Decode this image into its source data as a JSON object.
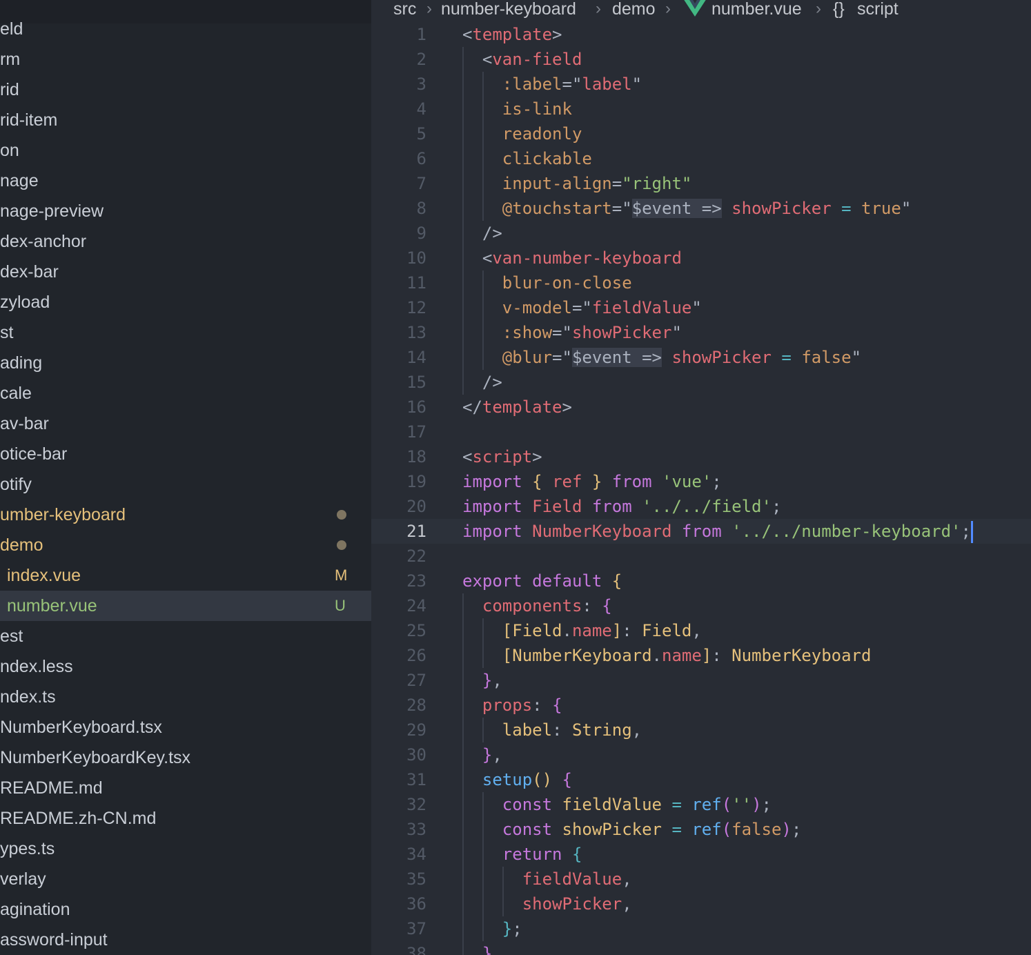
{
  "breadcrumb": {
    "src": "src",
    "folder": "number-keyboard",
    "sub": "demo",
    "file": "number.vue",
    "symbol_icon": "{}",
    "symbol": "script"
  },
  "colors": {
    "modified_badge": "#e5c07b",
    "untracked_badge": "#98c379"
  },
  "sidebar": {
    "items": [
      {
        "label": "eld"
      },
      {
        "label": "rm"
      },
      {
        "label": "rid"
      },
      {
        "label": "rid-item"
      },
      {
        "label": "on"
      },
      {
        "label": "nage"
      },
      {
        "label": "nage-preview"
      },
      {
        "label": "dex-anchor"
      },
      {
        "label": "dex-bar"
      },
      {
        "label": "zyload"
      },
      {
        "label": "st"
      },
      {
        "label": "ading"
      },
      {
        "label": "cale"
      },
      {
        "label": "av-bar"
      },
      {
        "label": "otice-bar"
      },
      {
        "label": "otify"
      },
      {
        "label": "umber-keyboard",
        "color": "#e5c07b",
        "dot": true
      },
      {
        "label": "demo",
        "color": "#e5c07b",
        "dot": true
      },
      {
        "label": "index.vue",
        "color": "#e5c07b",
        "badge": "M",
        "indent": true
      },
      {
        "label": "number.vue",
        "color": "#98c379",
        "badge": "U",
        "indent": true,
        "selected": true
      },
      {
        "label": "est"
      },
      {
        "label": "ndex.less"
      },
      {
        "label": "ndex.ts"
      },
      {
        "label": "NumberKeyboard.tsx"
      },
      {
        "label": "NumberKeyboardKey.tsx"
      },
      {
        "label": "README.md"
      },
      {
        "label": "README.zh-CN.md"
      },
      {
        "label": "ypes.ts"
      },
      {
        "label": "verlay"
      },
      {
        "label": "agination"
      },
      {
        "label": "assword-input"
      }
    ]
  },
  "editor": {
    "current_line": 21,
    "lines": [
      {
        "n": "1",
        "g": [],
        "s": [
          [
            "t-punc",
            "<"
          ],
          [
            "t-tag",
            "template"
          ],
          [
            "t-punc",
            ">"
          ]
        ]
      },
      {
        "n": "2",
        "g": [
          0
        ],
        "s": [
          [
            "t-punc",
            "  <"
          ],
          [
            "t-tag",
            "van-field"
          ]
        ]
      },
      {
        "n": "3",
        "g": [
          0,
          1
        ],
        "s": [
          [
            "t-attr",
            "    :label"
          ],
          [
            "t-punc",
            "=\""
          ],
          [
            "t-var",
            "label"
          ],
          [
            "t-punc",
            "\""
          ]
        ]
      },
      {
        "n": "4",
        "g": [
          0,
          1
        ],
        "s": [
          [
            "t-attr",
            "    is-link"
          ]
        ]
      },
      {
        "n": "5",
        "g": [
          0,
          1
        ],
        "s": [
          [
            "t-attr",
            "    readonly"
          ]
        ]
      },
      {
        "n": "6",
        "g": [
          0,
          1
        ],
        "s": [
          [
            "t-attr",
            "    clickable"
          ]
        ]
      },
      {
        "n": "7",
        "g": [
          0,
          1
        ],
        "s": [
          [
            "t-attr",
            "    input-align"
          ],
          [
            "t-punc",
            "="
          ],
          [
            "t-str",
            "\"right\""
          ]
        ]
      },
      {
        "n": "8",
        "g": [
          0,
          1
        ],
        "s": [
          [
            "t-attr",
            "    @touchstart"
          ],
          [
            "t-punc",
            "=\""
          ],
          [
            "t-hl",
            "$event =>"
          ],
          [
            "t-punc",
            " "
          ],
          [
            "t-var",
            "showPicker"
          ],
          [
            "t-punc",
            " "
          ],
          [
            "t-op",
            "="
          ],
          [
            "t-punc",
            " "
          ],
          [
            "t-num",
            "true"
          ],
          [
            "t-punc",
            "\""
          ]
        ]
      },
      {
        "n": "9",
        "g": [
          0
        ],
        "s": [
          [
            "t-punc",
            "  />"
          ]
        ]
      },
      {
        "n": "10",
        "g": [
          0
        ],
        "s": [
          [
            "t-punc",
            "  <"
          ],
          [
            "t-tag",
            "van-number-keyboard"
          ]
        ]
      },
      {
        "n": "11",
        "g": [
          0,
          1
        ],
        "s": [
          [
            "t-attr",
            "    blur-on-close"
          ]
        ]
      },
      {
        "n": "12",
        "g": [
          0,
          1
        ],
        "s": [
          [
            "t-attr",
            "    v-model"
          ],
          [
            "t-punc",
            "=\""
          ],
          [
            "t-var",
            "fieldValue"
          ],
          [
            "t-punc",
            "\""
          ]
        ]
      },
      {
        "n": "13",
        "g": [
          0,
          1
        ],
        "s": [
          [
            "t-attr",
            "    :show"
          ],
          [
            "t-punc",
            "=\""
          ],
          [
            "t-var",
            "showPicker"
          ],
          [
            "t-punc",
            "\""
          ]
        ]
      },
      {
        "n": "14",
        "g": [
          0,
          1
        ],
        "s": [
          [
            "t-attr",
            "    @blur"
          ],
          [
            "t-punc",
            "=\""
          ],
          [
            "t-hl",
            "$event =>"
          ],
          [
            "t-punc",
            " "
          ],
          [
            "t-var",
            "showPicker"
          ],
          [
            "t-punc",
            " "
          ],
          [
            "t-op",
            "="
          ],
          [
            "t-punc",
            " "
          ],
          [
            "t-num",
            "false"
          ],
          [
            "t-punc",
            "\""
          ]
        ]
      },
      {
        "n": "15",
        "g": [
          0
        ],
        "s": [
          [
            "t-punc",
            "  />"
          ]
        ]
      },
      {
        "n": "16",
        "g": [],
        "s": [
          [
            "t-punc",
            "</"
          ],
          [
            "t-tag",
            "template"
          ],
          [
            "t-punc",
            ">"
          ]
        ]
      },
      {
        "n": "17",
        "g": [],
        "s": []
      },
      {
        "n": "18",
        "g": [],
        "s": [
          [
            "t-punc",
            "<"
          ],
          [
            "t-tag",
            "script"
          ],
          [
            "t-punc",
            ">"
          ]
        ]
      },
      {
        "n": "19",
        "g": [],
        "s": [
          [
            "t-kw",
            "import"
          ],
          [
            "t-punc",
            " "
          ],
          [
            "t-cls",
            "{"
          ],
          [
            "t-punc",
            " "
          ],
          [
            "t-var",
            "ref"
          ],
          [
            "t-punc",
            " "
          ],
          [
            "t-cls",
            "}"
          ],
          [
            "t-punc",
            " "
          ],
          [
            "t-kw",
            "from"
          ],
          [
            "t-punc",
            " "
          ],
          [
            "t-str",
            "'vue'"
          ],
          [
            "t-punc",
            ";"
          ]
        ]
      },
      {
        "n": "20",
        "g": [],
        "s": [
          [
            "t-kw",
            "import"
          ],
          [
            "t-punc",
            " "
          ],
          [
            "t-var",
            "Field"
          ],
          [
            "t-punc",
            " "
          ],
          [
            "t-kw",
            "from"
          ],
          [
            "t-punc",
            " "
          ],
          [
            "t-str",
            "'../../field'"
          ],
          [
            "t-punc",
            ";"
          ]
        ]
      },
      {
        "n": "21",
        "g": [],
        "s": [
          [
            "t-kw",
            "import"
          ],
          [
            "t-punc",
            " "
          ],
          [
            "t-var",
            "NumberKeyboard"
          ],
          [
            "t-punc",
            " "
          ],
          [
            "t-kw",
            "from"
          ],
          [
            "t-punc",
            " "
          ],
          [
            "t-str",
            "'../../number-keyboard'"
          ],
          [
            "t-punc",
            ";"
          ]
        ]
      },
      {
        "n": "22",
        "g": [],
        "s": []
      },
      {
        "n": "23",
        "g": [],
        "s": [
          [
            "t-kw",
            "export"
          ],
          [
            "t-punc",
            " "
          ],
          [
            "t-kw",
            "default"
          ],
          [
            "t-punc",
            " "
          ],
          [
            "t-cls",
            "{"
          ]
        ]
      },
      {
        "n": "24",
        "g": [
          0
        ],
        "s": [
          [
            "t-var",
            "  components"
          ],
          [
            "t-punc",
            ": "
          ],
          [
            "t-kw",
            "{"
          ]
        ]
      },
      {
        "n": "25",
        "g": [
          0,
          1
        ],
        "s": [
          [
            "t-cls",
            "    ["
          ],
          [
            "t-cls",
            "Field"
          ],
          [
            "t-punc",
            "."
          ],
          [
            "t-var",
            "name"
          ],
          [
            "t-cls",
            "]"
          ],
          [
            "t-punc",
            ": "
          ],
          [
            "t-cls",
            "Field"
          ],
          [
            "t-punc",
            ","
          ]
        ]
      },
      {
        "n": "26",
        "g": [
          0,
          1
        ],
        "s": [
          [
            "t-cls",
            "    ["
          ],
          [
            "t-cls",
            "NumberKeyboard"
          ],
          [
            "t-punc",
            "."
          ],
          [
            "t-var",
            "name"
          ],
          [
            "t-cls",
            "]"
          ],
          [
            "t-punc",
            ": "
          ],
          [
            "t-cls",
            "NumberKeyboard"
          ]
        ]
      },
      {
        "n": "27",
        "g": [
          0
        ],
        "s": [
          [
            "t-kw",
            "  }"
          ],
          [
            "t-punc",
            ","
          ]
        ]
      },
      {
        "n": "28",
        "g": [
          0
        ],
        "s": [
          [
            "t-var",
            "  props"
          ],
          [
            "t-punc",
            ": "
          ],
          [
            "t-kw",
            "{"
          ]
        ]
      },
      {
        "n": "29",
        "g": [
          0,
          1
        ],
        "s": [
          [
            "t-cls",
            "    label"
          ],
          [
            "t-punc",
            ": "
          ],
          [
            "t-cls",
            "String"
          ],
          [
            "t-punc",
            ","
          ]
        ]
      },
      {
        "n": "30",
        "g": [
          0
        ],
        "s": [
          [
            "t-kw",
            "  }"
          ],
          [
            "t-punc",
            ","
          ]
        ]
      },
      {
        "n": "31",
        "g": [
          0
        ],
        "s": [
          [
            "t-fn",
            "  setup"
          ],
          [
            "t-cls",
            "()"
          ],
          [
            "t-punc",
            " "
          ],
          [
            "t-kw",
            "{"
          ]
        ]
      },
      {
        "n": "32",
        "g": [
          0,
          1
        ],
        "s": [
          [
            "t-kw",
            "    const"
          ],
          [
            "t-punc",
            " "
          ],
          [
            "t-cls",
            "fieldValue"
          ],
          [
            "t-punc",
            " "
          ],
          [
            "t-op",
            "="
          ],
          [
            "t-punc",
            " "
          ],
          [
            "t-fn",
            "ref"
          ],
          [
            "t-kw",
            "("
          ],
          [
            "t-str",
            "''"
          ],
          [
            "t-kw",
            ")"
          ],
          [
            "t-punc",
            ";"
          ]
        ]
      },
      {
        "n": "33",
        "g": [
          0,
          1
        ],
        "s": [
          [
            "t-kw",
            "    const"
          ],
          [
            "t-punc",
            " "
          ],
          [
            "t-cls",
            "showPicker"
          ],
          [
            "t-punc",
            " "
          ],
          [
            "t-op",
            "="
          ],
          [
            "t-punc",
            " "
          ],
          [
            "t-fn",
            "ref"
          ],
          [
            "t-kw",
            "("
          ],
          [
            "t-num",
            "false"
          ],
          [
            "t-kw",
            ")"
          ],
          [
            "t-punc",
            ";"
          ]
        ]
      },
      {
        "n": "34",
        "g": [
          0,
          1
        ],
        "s": [
          [
            "t-kw",
            "    return"
          ],
          [
            "t-punc",
            " "
          ],
          [
            "t-op",
            "{"
          ]
        ]
      },
      {
        "n": "35",
        "g": [
          0,
          1,
          2
        ],
        "s": [
          [
            "t-var",
            "      fieldValue"
          ],
          [
            "t-punc",
            ","
          ]
        ]
      },
      {
        "n": "36",
        "g": [
          0,
          1,
          2
        ],
        "s": [
          [
            "t-var",
            "      showPicker"
          ],
          [
            "t-punc",
            ","
          ]
        ]
      },
      {
        "n": "37",
        "g": [
          0,
          1
        ],
        "s": [
          [
            "t-op",
            "    }"
          ],
          [
            "t-punc",
            ";"
          ]
        ]
      },
      {
        "n": "38",
        "g": [
          0
        ],
        "s": [
          [
            "t-kw",
            "  }"
          ]
        ]
      }
    ]
  }
}
